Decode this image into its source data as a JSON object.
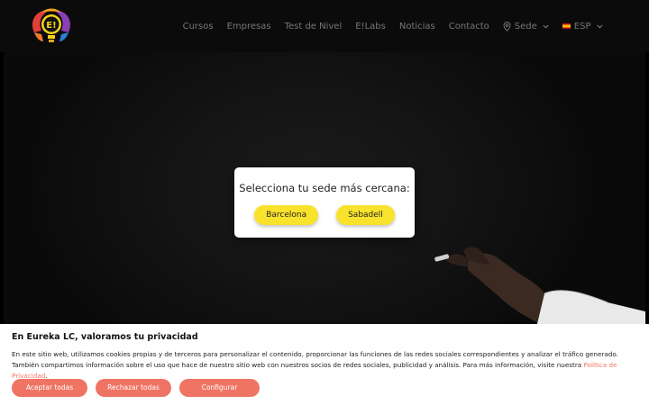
{
  "header": {
    "logo_text": "E!",
    "nav": [
      {
        "label": "Cursos"
      },
      {
        "label": "Empresas"
      },
      {
        "label": "Test de Nivel"
      },
      {
        "label": "E!Labs"
      },
      {
        "label": "Noticias"
      },
      {
        "label": "Contacto"
      }
    ],
    "sede_label": "Sede",
    "language_label": "ESP"
  },
  "modal": {
    "title": "Selecciona tu sede más cercana:",
    "buttons": [
      {
        "label": "Barcelona"
      },
      {
        "label": "Sabadell"
      }
    ]
  },
  "cookie_banner": {
    "title": "En Eureka LC, valoramos tu privacidad",
    "text": "En este sitio web, utilizamos cookies propias y de terceros para personalizar el contenido, proporcionar las funciones de las redes sociales correspondientes y analizar el tráfico generado. También compartimos información sobre el uso que hace de nuestro sitio web con nuestros socios de redes sociales, publicidad y análisis. Para más información, visite nuestra ",
    "link_text": "Política de Privacidad",
    "text_end": ".",
    "buttons": {
      "accept": "Aceptar todas",
      "reject": "Rechazar todas",
      "configure": "Configurar"
    }
  },
  "colors": {
    "accent_yellow": "#f9e22b",
    "cookie_button": "#ef7463",
    "header_bg": "#0b0b0b"
  },
  "icons": {
    "logo": "logo-icon",
    "sede": "map-pin-icon",
    "dropdown": "chevron-down-icon",
    "language_flag": "spain-flag-icon"
  }
}
